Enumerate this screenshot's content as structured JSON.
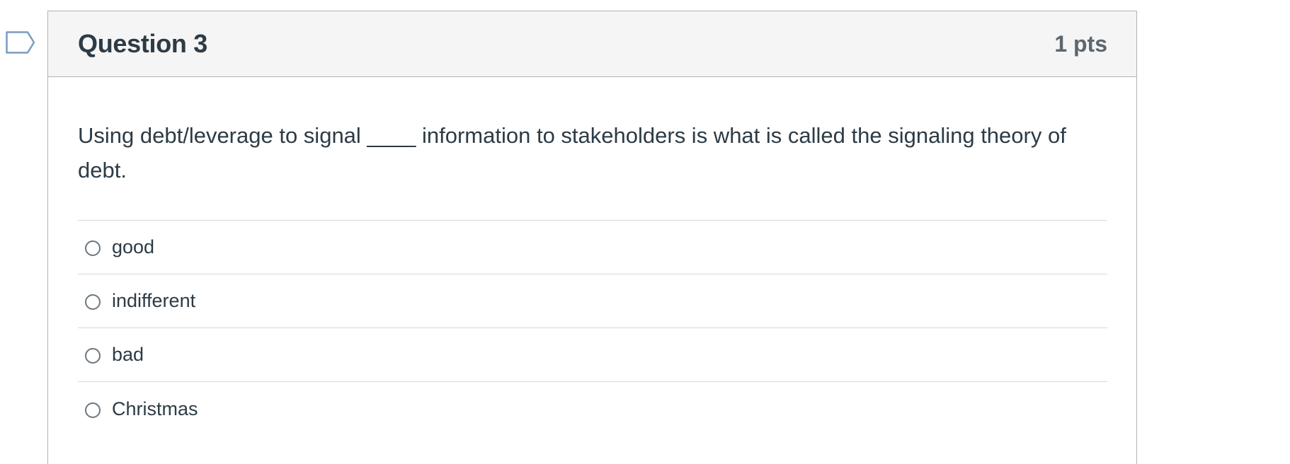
{
  "question": {
    "title": "Question 3",
    "points": "1 pts",
    "text": "Using debt/leverage to signal ____ information to stakeholders is what is called the signaling theory of debt.",
    "answers": [
      {
        "label": "good",
        "selected": false
      },
      {
        "label": "indifferent",
        "selected": false
      },
      {
        "label": "bad",
        "selected": false
      },
      {
        "label": "Christmas",
        "selected": false
      }
    ]
  },
  "icons": {
    "flag": "flag-question-icon"
  },
  "colors": {
    "header_bg": "#f5f5f5",
    "border": "#aeb4b9",
    "text": "#2d3b45",
    "points_text": "#5b6770",
    "flag_stroke": "#7a9cc0"
  }
}
